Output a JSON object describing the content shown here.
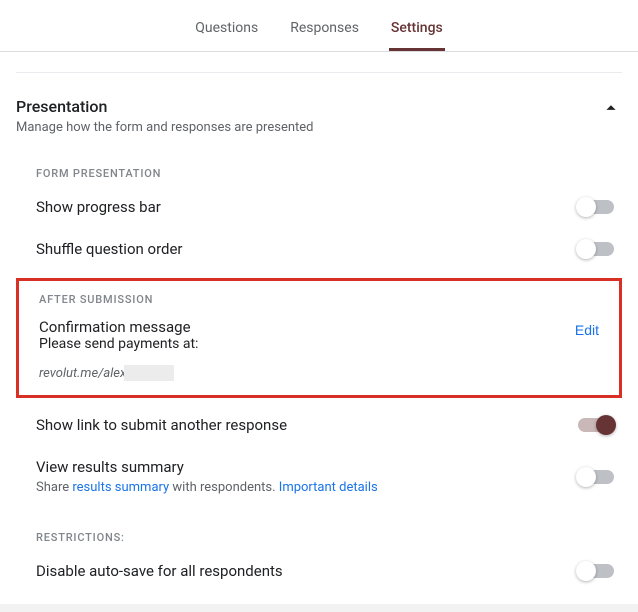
{
  "tabs": {
    "questions": "Questions",
    "responses": "Responses",
    "settings": "Settings"
  },
  "section": {
    "title": "Presentation",
    "subtitle": "Manage how the form and responses are presented"
  },
  "groups": {
    "form_presentation": "FORM PRESENTATION",
    "after_submission": "AFTER SUBMISSION",
    "restrictions": "RESTRICTIONS:"
  },
  "items": {
    "progress_bar": "Show progress bar",
    "shuffle": "Shuffle question order",
    "confirmation_label": "Confirmation message",
    "confirmation_text": "Please send payments at:",
    "confirmation_value": "revolut.me/alex",
    "edit": "Edit",
    "submit_another": "Show link to submit another response",
    "results_label": "View results summary",
    "results_sub_pre": "Share ",
    "results_sub_link1": "results summary",
    "results_sub_mid": " with respondents. ",
    "results_sub_link2": "Important details",
    "disable_autosave": "Disable auto-save for all respondents"
  }
}
